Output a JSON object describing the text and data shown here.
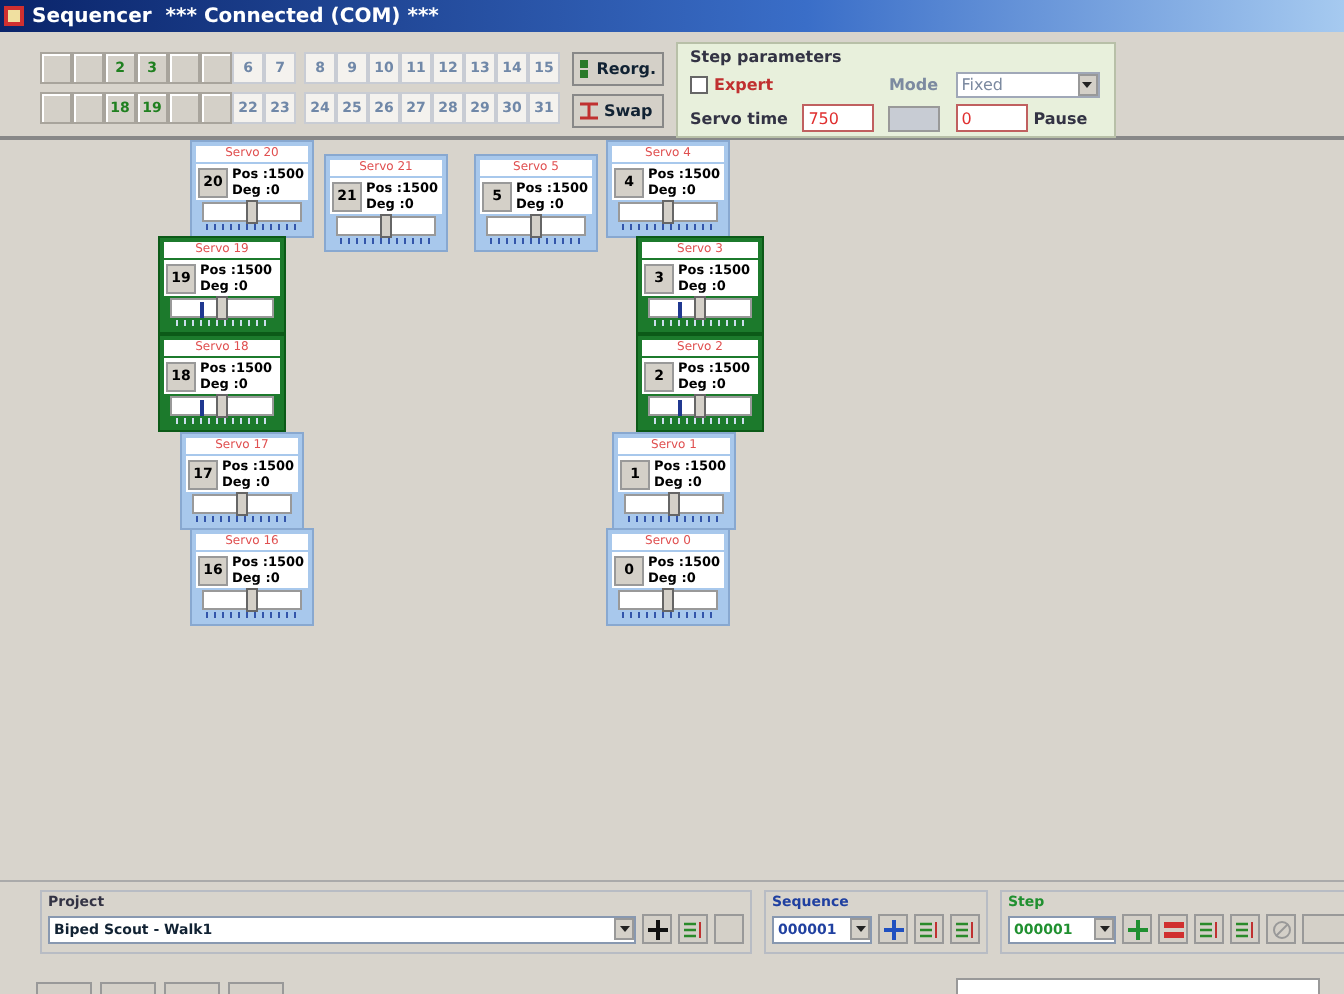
{
  "window": {
    "title": "Sequencer  *** Connected (COM) ***"
  },
  "servo_buttons": [
    [
      {
        "kind": "blank"
      },
      {
        "kind": "blank"
      },
      {
        "label": "2",
        "kind": "active"
      },
      {
        "label": "3",
        "kind": "active"
      },
      {
        "kind": "blank"
      },
      {
        "kind": "blank"
      },
      {
        "label": "6",
        "kind": "disabled"
      },
      {
        "label": "7",
        "kind": "disabled"
      },
      {
        "label": "8",
        "kind": "disabled"
      },
      {
        "label": "9",
        "kind": "disabled"
      },
      {
        "label": "10",
        "kind": "disabled"
      },
      {
        "label": "11",
        "kind": "disabled"
      },
      {
        "label": "12",
        "kind": "disabled"
      },
      {
        "label": "13",
        "kind": "disabled"
      },
      {
        "label": "14",
        "kind": "disabled"
      },
      {
        "label": "15",
        "kind": "disabled"
      }
    ],
    [
      {
        "kind": "blank"
      },
      {
        "kind": "blank"
      },
      {
        "label": "18",
        "kind": "active"
      },
      {
        "label": "19",
        "kind": "active"
      },
      {
        "kind": "blank"
      },
      {
        "kind": "blank"
      },
      {
        "label": "22",
        "kind": "disabled"
      },
      {
        "label": "23",
        "kind": "disabled"
      },
      {
        "label": "24",
        "kind": "disabled"
      },
      {
        "label": "25",
        "kind": "disabled"
      },
      {
        "label": "26",
        "kind": "disabled"
      },
      {
        "label": "27",
        "kind": "disabled"
      },
      {
        "label": "28",
        "kind": "disabled"
      },
      {
        "label": "29",
        "kind": "disabled"
      },
      {
        "label": "30",
        "kind": "disabled"
      },
      {
        "label": "31",
        "kind": "disabled"
      }
    ]
  ],
  "reorg_button": "Reorg.",
  "swap_button": "Swap",
  "step_parameters": {
    "title": "Step parameters",
    "expert": {
      "label": "Expert",
      "checked": false
    },
    "mode_label": "Mode",
    "mode_value": "Fixed",
    "servo_time_label": "Servo time",
    "servo_time": "750",
    "pause": "0",
    "pause_label": "Pause"
  },
  "servos": [
    {
      "name": "Servo 20",
      "number": "20",
      "pos": "Pos :1500",
      "deg": "Deg :0",
      "selected": false,
      "level": 0.5
    },
    {
      "name": "Servo 21",
      "number": "21",
      "pos": "Pos :1500",
      "deg": "Deg :0",
      "selected": false,
      "level": 0.5
    },
    {
      "name": "Servo 5",
      "number": "5",
      "pos": "Pos :1500",
      "deg": "Deg :0",
      "selected": false,
      "level": 0.5
    },
    {
      "name": "Servo 4",
      "number": "4",
      "pos": "Pos :1500",
      "deg": "Deg :0",
      "selected": false,
      "level": 0.5
    },
    {
      "name": "Servo 19",
      "number": "19",
      "pos": "Pos :1500",
      "deg": "Deg :0",
      "selected": true,
      "level": 0.5
    },
    {
      "name": "Servo 3",
      "number": "3",
      "pos": "Pos :1500",
      "deg": "Deg :0",
      "selected": true,
      "level": 0.5
    },
    {
      "name": "Servo 18",
      "number": "18",
      "pos": "Pos :1500",
      "deg": "Deg :0",
      "selected": true,
      "level": 0.5
    },
    {
      "name": "Servo 2",
      "number": "2",
      "pos": "Pos :1500",
      "deg": "Deg :0",
      "selected": true,
      "level": 0.5
    },
    {
      "name": "Servo 17",
      "number": "17",
      "pos": "Pos :1500",
      "deg": "Deg :0",
      "selected": false,
      "level": 0.5
    },
    {
      "name": "Servo 1",
      "number": "1",
      "pos": "Pos :1500",
      "deg": "Deg :0",
      "selected": false,
      "level": 0.5
    },
    {
      "name": "Servo 16",
      "number": "16",
      "pos": "Pos :1500",
      "deg": "Deg :0",
      "selected": false,
      "level": 0.5
    },
    {
      "name": "Servo 0",
      "number": "0",
      "pos": "Pos :1500",
      "deg": "Deg :0",
      "selected": false,
      "level": 0.5
    }
  ],
  "project": {
    "title": "Project",
    "value": "Biped Scout - Walk1"
  },
  "sequence": {
    "title": "Sequence",
    "value": "000001"
  },
  "step": {
    "title": "Step",
    "value": "000001"
  }
}
